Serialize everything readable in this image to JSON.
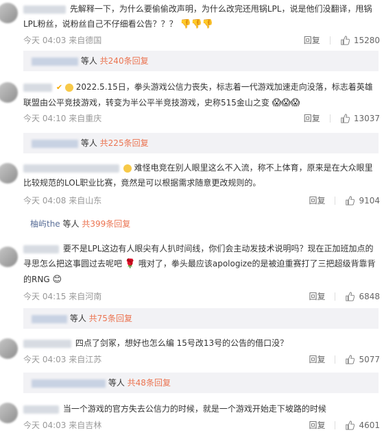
{
  "comments": [
    {
      "text": "先解释一下，为什么要偷偷改声明，为什么改完还甩锅LPL，说是他们没翻译，甩锅LPL粉丝，说粉丝自己不仔细看公告？？？",
      "time": "今天 04:03 来自德国",
      "reply_label": "回复",
      "likes": "15280",
      "replies_summary": {
        "suffix": "等人",
        "count": "共240条回复"
      }
    },
    {
      "text": "2022.5.15日，拳头游戏公信力丧失，标志着一代游戏加速走向没落，标志着英雄联盟由公平竞技游戏，转变为半公平半竞技游戏，史称515金山之变",
      "time": "今天 04:10 来自重庆",
      "reply_label": "回复",
      "likes": "13037",
      "replies_summary": {
        "suffix": "等人",
        "count": "共225条回复"
      }
    },
    {
      "text": "难怪电竞在别人眼里这么不入流，称不上体育，原来是在大众眼里比较规范的LOL职业比赛，竟然是可以根据需求随意更改规则的。",
      "time": "今天 04:08 来自山东",
      "reply_label": "回复",
      "likes": "9104",
      "replies_summary": {
        "name": "柚屿the",
        "suffix": "等人",
        "count": "共399条回复"
      }
    },
    {
      "text": "要不是LPL这边有人眼尖有人扒时间线，你们会主动发技术说明吗？现在正加班加点的寻思怎么把这事圆过去呢吧",
      "text2": "哦对了，拳头最应该apologize的是被迫重赛打了三把超级背靠背的RNG",
      "time": "今天 04:15 来自河南",
      "reply_label": "回复",
      "likes": "6848",
      "replies_summary": {
        "suffix": "等人",
        "count": "共75条回复"
      }
    },
    {
      "text": "四点了剑冢，想好也怎么编 15号改13号的公告的借口没？",
      "time": "今天 04:03 来自江苏",
      "reply_label": "回复",
      "likes": "5077",
      "replies_summary": {
        "suffix": "等人",
        "count": "共48条回复"
      }
    },
    {
      "text": "当一个游戏的官方失去公信力的时候，就是一个游戏开始走下坡路的时候",
      "time": "今天 04:03 来自吉林",
      "reply_label": "回复",
      "likes": "4601"
    }
  ],
  "icons": {
    "like": "thumbs-up-icon",
    "emoji": "face-emoji-icon"
  },
  "colors": {
    "reply_link": "#eb7350",
    "meta": "#999999",
    "reply_bg": "#f2f2f5"
  }
}
